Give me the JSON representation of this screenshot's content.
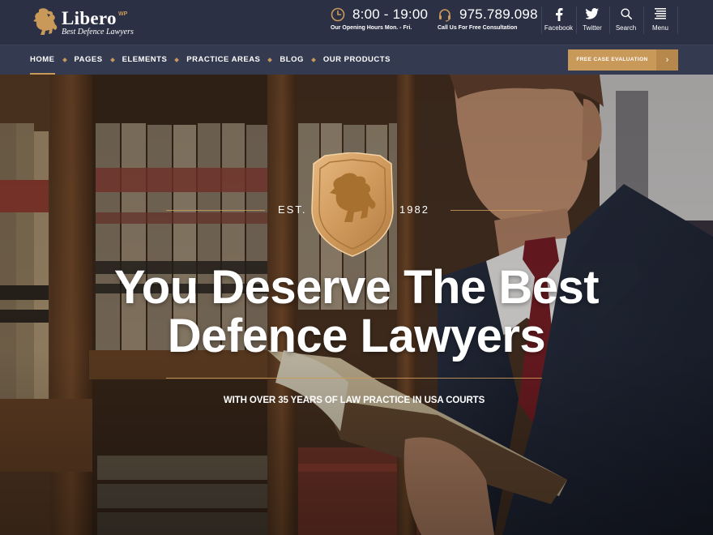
{
  "brand": {
    "name": "Libero",
    "superscript": "WP",
    "tagline": "Best Defence Lawyers"
  },
  "header": {
    "hours": {
      "value": "8:00 - 19:00",
      "caption": "Our Opening Hours Mon. - Fri.",
      "icon": "clock-icon"
    },
    "phone": {
      "value": "975.789.098",
      "caption": "Call Us For Free Consultation",
      "icon": "headset-icon"
    },
    "social": [
      {
        "label": "Facebook",
        "icon": "facebook-icon"
      },
      {
        "label": "Twitter",
        "icon": "twitter-icon"
      },
      {
        "label": "Search",
        "icon": "search-icon"
      },
      {
        "label": "Menu",
        "icon": "menu-icon"
      }
    ]
  },
  "nav": {
    "items": [
      "HOME",
      "PAGES",
      "ELEMENTS",
      "PRACTICE AREAS",
      "BLOG",
      "OUR PRODUCTS"
    ],
    "active_index": 0,
    "cta_label": "FREE CASE EVALUATION",
    "cta_arrow": "›"
  },
  "hero": {
    "est_left": "EST.",
    "est_right": "1982",
    "headline_line1": "You Deserve The Best",
    "headline_line2": "Defence Lawyers",
    "subheading": "WITH OVER 35 YEARS OF LAW PRACTICE IN USA COURTS"
  },
  "colors": {
    "accent": "#c9995a",
    "topbar": "#2b3044",
    "navbar": "#343a50"
  }
}
